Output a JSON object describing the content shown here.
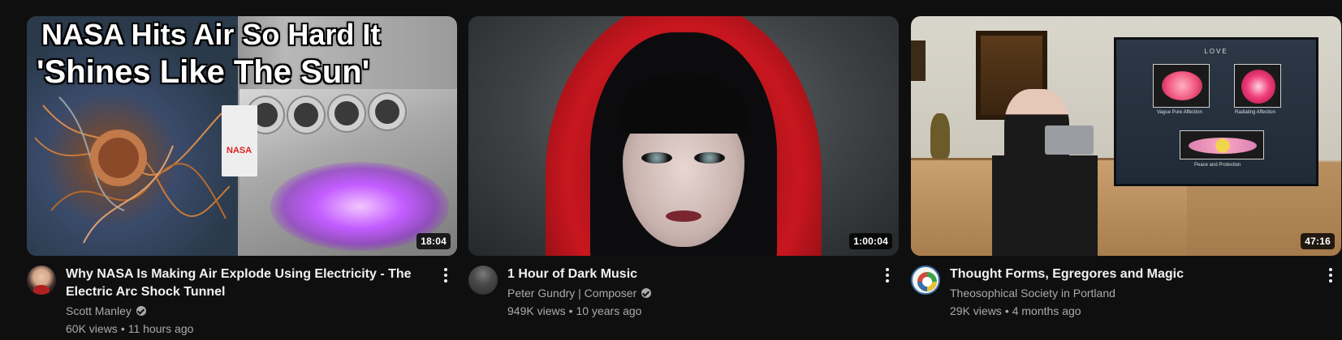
{
  "videos": [
    {
      "title": "Why NASA Is Making Air Explode Using Electricity - The Electric Arc Shock Tunnel",
      "channel": "Scott Manley",
      "verified": true,
      "views": "60K views",
      "age": "11 hours ago",
      "duration": "18:04",
      "thumb_text_line1": "NASA Hits Air So Hard It",
      "thumb_text_line2": "'Shines Like The Sun'",
      "thumb_tag": "NASA"
    },
    {
      "title": "1 Hour of Dark Music",
      "channel": "Peter Gundry | Composer",
      "verified": true,
      "views": "949K views",
      "age": "10 years ago",
      "duration": "1:00:04"
    },
    {
      "title": "Thought Forms, Egregores and Magic",
      "channel": "Theosophical Society in Portland",
      "verified": false,
      "views": "29K views",
      "age": "4 months ago",
      "duration": "47:16",
      "slide": {
        "title": "LOVE",
        "caption1": "Vague Pure Affection",
        "caption2": "Radiating Affection",
        "caption3": "Peace and Protection"
      }
    }
  ],
  "separator": "•",
  "icons": [
    "verified-check-icon",
    "more-vert-icon"
  ]
}
